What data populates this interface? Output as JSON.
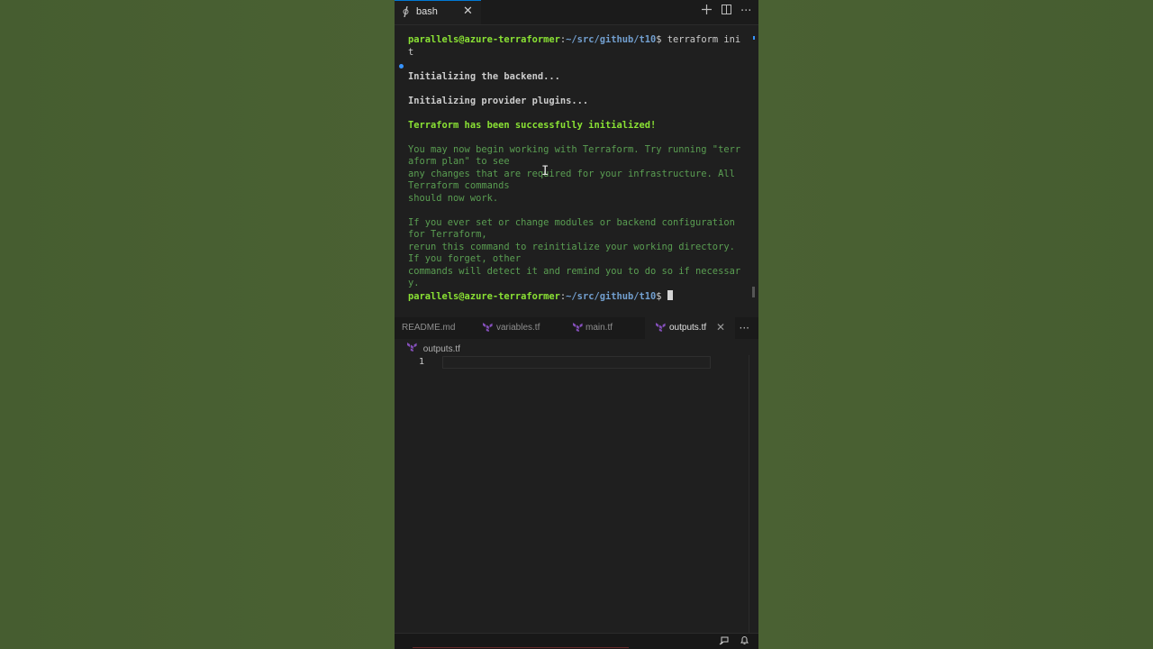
{
  "terminal": {
    "tab_label": "bash",
    "lines": [
      {
        "prompt_user": "parallels@azure-terraformer",
        "prompt_path": "~/src/github/t10",
        "prompt_sign": "$ ",
        "command": "terraform ini"
      },
      {
        "text": "t",
        "style": "plain"
      },
      {
        "text": "",
        "style": "plain"
      },
      {
        "text": "Initializing the backend...",
        "style": "bold"
      },
      {
        "text": "",
        "style": "plain"
      },
      {
        "text": "Initializing provider plugins...",
        "style": "bold"
      },
      {
        "text": "",
        "style": "plain"
      },
      {
        "text": "Terraform has been successfully initialized!",
        "style": "gbold"
      },
      {
        "text": "",
        "style": "plain"
      },
      {
        "text": "You may now begin working with Terraform. Try running \"terr",
        "style": "muted"
      },
      {
        "text": "aform plan\" to see",
        "style": "muted"
      },
      {
        "text": "any changes that are required for your infrastructure. All",
        "style": "muted"
      },
      {
        "text": "Terraform commands",
        "style": "muted"
      },
      {
        "text": "should now work.",
        "style": "muted"
      },
      {
        "text": "",
        "style": "plain"
      },
      {
        "text": "If you ever set or change modules or backend configuration",
        "style": "muted"
      },
      {
        "text": "for Terraform,",
        "style": "muted"
      },
      {
        "text": "rerun this command to reinitialize your working directory.",
        "style": "muted"
      },
      {
        "text": "If you forget, other",
        "style": "muted"
      },
      {
        "text": "commands will detect it and remind you to do so if necessar",
        "style": "muted"
      },
      {
        "text": "y.",
        "style": "muted"
      },
      {
        "prompt_user": "parallels@azure-terraformer",
        "prompt_path": "~/src/github/t10",
        "prompt_sign": "$ ",
        "command": "",
        "cursor": true
      }
    ]
  },
  "editor": {
    "tabs": [
      {
        "label": "README.md",
        "active": false
      },
      {
        "label": "variables.tf",
        "active": false
      },
      {
        "label": "main.tf",
        "active": false
      },
      {
        "label": "outputs.tf",
        "active": true
      }
    ],
    "breadcrumb": "outputs.tf",
    "line_numbers": [
      "1"
    ]
  },
  "colors": {
    "accent": "#0078d4",
    "terraform_icon": "#844fba",
    "success": "#8ae234"
  },
  "icons": {
    "terminal_tab": "shell-icon",
    "new_terminal": "plus-icon",
    "split": "split-icon",
    "more": "ellipsis-icon",
    "status_feedback": "feedback-icon",
    "status_bell": "bell-icon"
  }
}
